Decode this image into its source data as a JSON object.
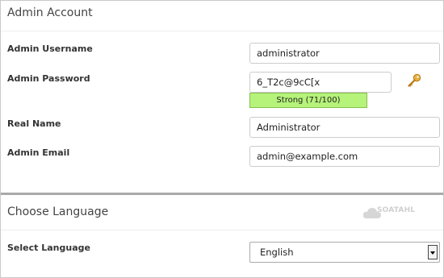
{
  "admin_account": {
    "title": "Admin Account",
    "username": {
      "label": "Admin Username",
      "value": "administrator"
    },
    "password": {
      "label": "Admin Password",
      "value": "6_T2c@9cC[x",
      "strength": "Strong (71/100)"
    },
    "real_name": {
      "label": "Real Name",
      "value": "Administrator"
    },
    "email": {
      "label": "Admin Email",
      "value": "admin@example.com"
    }
  },
  "language": {
    "title": "Choose Language",
    "select_label": "Select Language",
    "selected": "English"
  },
  "logo": {
    "text": "SOATAHL"
  },
  "colors": {
    "strength_bg": "#b5f37a",
    "strength_border": "#86c04a",
    "key_icon": "#d79a2b"
  }
}
